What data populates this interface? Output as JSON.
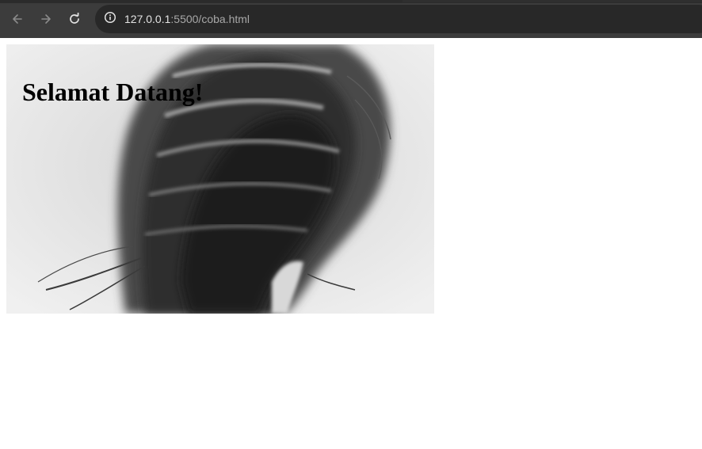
{
  "browser": {
    "url_host": "127.0.0.1",
    "url_path": ":5500/coba.html",
    "icons": {
      "back": "arrow-left-icon",
      "forward": "arrow-right-icon",
      "reload": "reload-icon",
      "site_info": "info-icon"
    }
  },
  "page": {
    "heading": "Selamat Datang!",
    "hero_image": "black-and-white photo of a person with motion-blurred hair"
  },
  "colors": {
    "chrome_bg": "#3c3c3c",
    "omnibox_bg": "#282828",
    "page_bg": "#ffffff",
    "heading_text": "#000000"
  }
}
